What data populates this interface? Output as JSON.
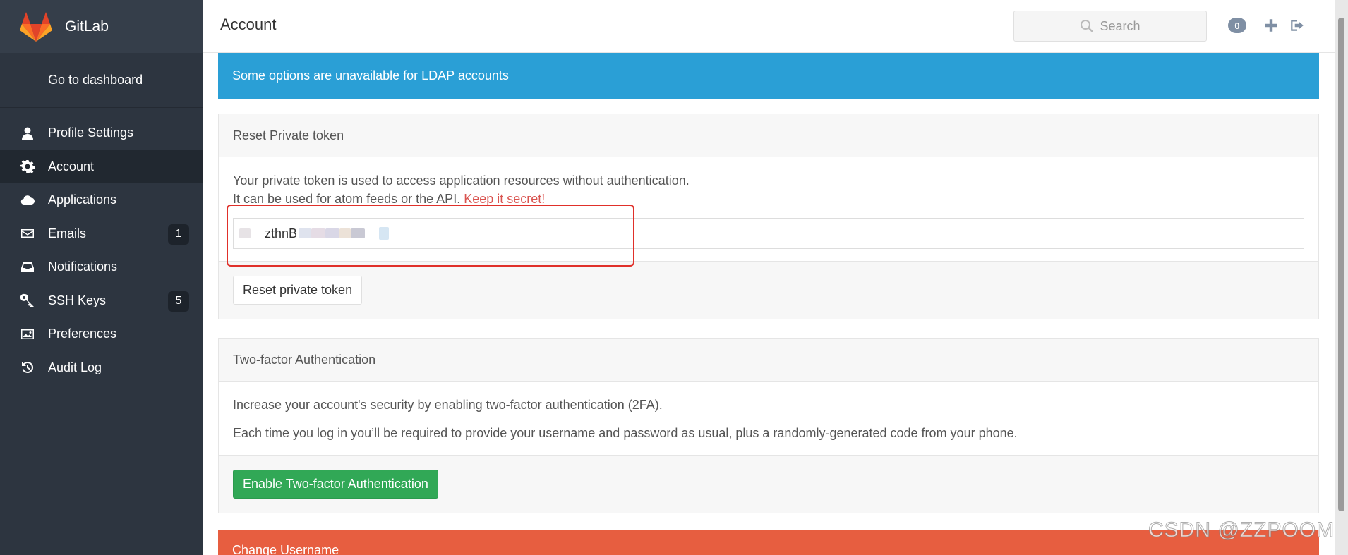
{
  "brand": {
    "name": "GitLab"
  },
  "sidebar": {
    "dashboard_link": "Go to dashboard",
    "items": [
      {
        "label": "Profile Settings",
        "icon": "user-icon"
      },
      {
        "label": "Account",
        "icon": "gear-icon",
        "active": true
      },
      {
        "label": "Applications",
        "icon": "cloud-icon"
      },
      {
        "label": "Emails",
        "icon": "envelope-icon",
        "badge": "1"
      },
      {
        "label": "Notifications",
        "icon": "inbox-icon"
      },
      {
        "label": "SSH Keys",
        "icon": "key-icon",
        "badge": "5"
      },
      {
        "label": "Preferences",
        "icon": "image-icon"
      },
      {
        "label": "Audit Log",
        "icon": "history-icon"
      }
    ]
  },
  "header": {
    "title": "Account",
    "search_placeholder": "Search",
    "todo_count": "0"
  },
  "alert": {
    "text": "Some options are unavailable for LDAP accounts"
  },
  "token_panel": {
    "title": "Reset Private token",
    "line1": "Your private token is used to access application resources without authentication.",
    "line2": "It can be used for atom feeds or the API.",
    "secret": "Keep it secret!",
    "token_value": "zthnB",
    "button": "Reset private token"
  },
  "twofa_panel": {
    "title": "Two-factor Authentication",
    "line1": "Increase your account's security by enabling two-factor authentication (2FA).",
    "line2": "Each time you log in you’ll be required to provide your username and password as usual, plus a randomly-generated code from your phone.",
    "button": "Enable Two-factor Authentication"
  },
  "username_panel": {
    "title": "Change Username"
  },
  "watermark": "CSDN @ZZPOOM",
  "colors": {
    "sidebar": "#2d3540",
    "info": "#2a9fd6",
    "success": "#31a856",
    "danger": "#e75e40",
    "secret": "#d9534f"
  }
}
